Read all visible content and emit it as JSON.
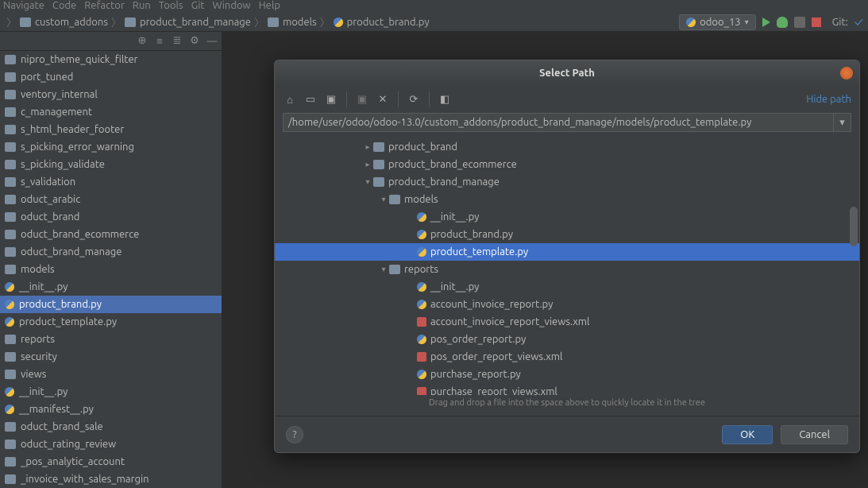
{
  "menubar": [
    "Navigate",
    "Code",
    "Refactor",
    "Run",
    "Tools",
    "Git",
    "Window",
    "Help"
  ],
  "breadcrumb": {
    "items": [
      "custom_addons",
      "product_brand_manage",
      "models",
      "product_brand.py"
    ]
  },
  "run": {
    "config_name": "odoo_13",
    "git_label": "Git:"
  },
  "sidebar_tree": [
    {
      "t": "folder",
      "label": "nipro_theme_quick_filter"
    },
    {
      "t": "folder",
      "label": "port_tuned"
    },
    {
      "t": "folder",
      "label": "ventory_internal"
    },
    {
      "t": "folder",
      "label": "c_management"
    },
    {
      "t": "folder",
      "label": "s_html_header_footer"
    },
    {
      "t": "folder",
      "label": "s_picking_error_warning"
    },
    {
      "t": "folder",
      "label": "s_picking_validate"
    },
    {
      "t": "folder",
      "label": "s_validation"
    },
    {
      "t": "folder",
      "label": "oduct_arabic"
    },
    {
      "t": "folder",
      "label": "oduct_brand"
    },
    {
      "t": "folder",
      "label": "oduct_brand_ecommerce"
    },
    {
      "t": "folder",
      "label": "oduct_brand_manage"
    },
    {
      "t": "folder",
      "label": "models"
    },
    {
      "t": "py",
      "label": "__init__.py"
    },
    {
      "t": "py",
      "label": "product_brand.py",
      "sel": true
    },
    {
      "t": "py",
      "label": "product_template.py"
    },
    {
      "t": "folder",
      "label": "reports"
    },
    {
      "t": "folder",
      "label": "security"
    },
    {
      "t": "folder",
      "label": "views"
    },
    {
      "t": "py",
      "label": "__init__.py"
    },
    {
      "t": "py",
      "label": "__manifest__.py"
    },
    {
      "t": "folder",
      "label": "oduct_brand_sale"
    },
    {
      "t": "folder",
      "label": "oduct_rating_review"
    },
    {
      "t": "folder",
      "label": "_pos_analytic_account"
    },
    {
      "t": "folder",
      "label": "_invoice_with_sales_margin"
    }
  ],
  "modal": {
    "title": "Select Path",
    "hide_path": "Hide path",
    "path": "/home/user/odoo/odoo-13.0/custom_addons/product_brand_manage/models/product_template.py",
    "hint": "Drag and drop a file into the space above to quickly locate it in the tree",
    "ok": "OK",
    "cancel": "Cancel",
    "tree": [
      {
        "d": 110,
        "a": "r",
        "t": "folder",
        "label": "product_brand"
      },
      {
        "d": 110,
        "a": "r",
        "t": "folder",
        "label": "product_brand_ecommerce"
      },
      {
        "d": 110,
        "a": "d",
        "t": "folder",
        "label": "product_brand_manage"
      },
      {
        "d": 130,
        "a": "d",
        "t": "folder",
        "label": "models"
      },
      {
        "d": 165,
        "a": "",
        "t": "py",
        "label": "__init__.py"
      },
      {
        "d": 165,
        "a": "",
        "t": "py",
        "label": "product_brand.py"
      },
      {
        "d": 165,
        "a": "",
        "t": "py",
        "label": "product_template.py",
        "sel": true
      },
      {
        "d": 130,
        "a": "d",
        "t": "folder",
        "label": "reports"
      },
      {
        "d": 165,
        "a": "",
        "t": "py",
        "label": "__init__.py"
      },
      {
        "d": 165,
        "a": "",
        "t": "py",
        "label": "account_invoice_report.py"
      },
      {
        "d": 165,
        "a": "",
        "t": "xml",
        "label": "account_invoice_report_views.xml"
      },
      {
        "d": 165,
        "a": "",
        "t": "py",
        "label": "pos_order_report.py"
      },
      {
        "d": 165,
        "a": "",
        "t": "xml",
        "label": "pos_order_report_views.xml"
      },
      {
        "d": 165,
        "a": "",
        "t": "py",
        "label": "purchase_report.py"
      },
      {
        "d": 165,
        "a": "",
        "t": "xml",
        "label": "purchase_report_views.xml"
      }
    ]
  }
}
